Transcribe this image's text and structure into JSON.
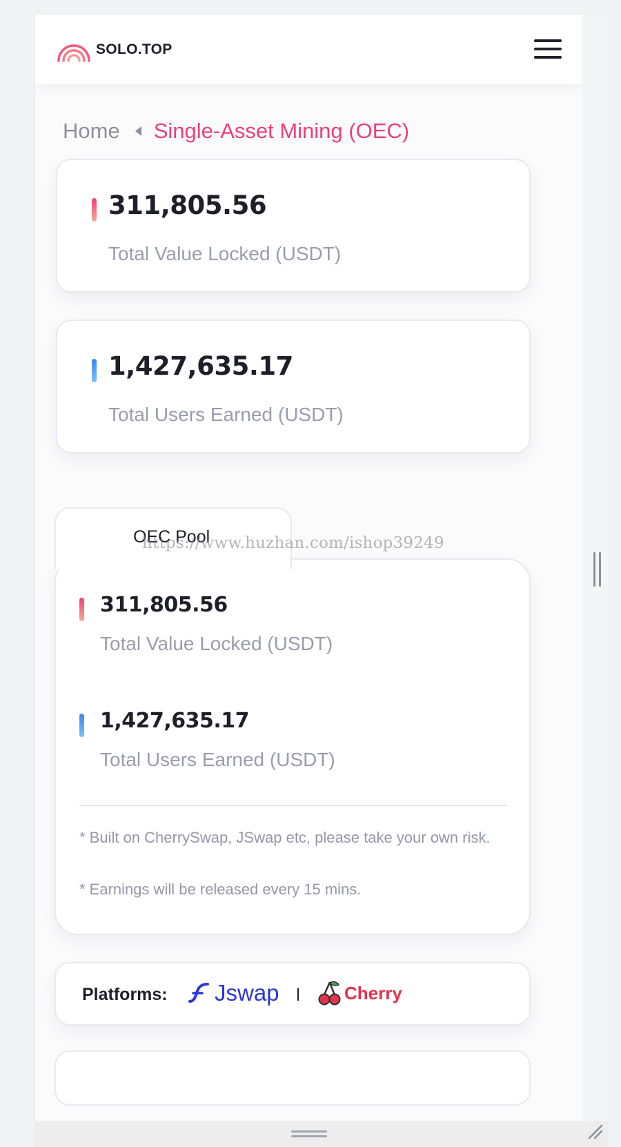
{
  "header": {
    "logo_text": "SOLO.TOP",
    "menu_icon": "hamburger-menu-icon"
  },
  "breadcrumb": {
    "home": "Home",
    "current": "Single-Asset Mining (OEC)"
  },
  "summary": [
    {
      "value": "311,805.56",
      "label": "Total Value Locked (USDT)",
      "accent": "#f0407a"
    },
    {
      "value": "1,427,635.17",
      "label": "Total Users Earned (USDT)",
      "accent": "#3a86f5"
    }
  ],
  "pool": {
    "tab_label": "OEC Pool",
    "stats": [
      {
        "value": "311,805.56",
        "label": "Total Value Locked (USDT)"
      },
      {
        "value": "1,427,635.17",
        "label": "Total Users Earned (USDT)"
      }
    ],
    "notes": [
      "* Built on CherrySwap, JSwap etc, please take your own risk.",
      "* Earnings will be released every 15 mins."
    ]
  },
  "watermark": "https://www.huzhan.com/ishop39249",
  "platforms": {
    "label": "Platforms:",
    "items": [
      {
        "name": "Jswap",
        "icon": "jswap-logo-icon",
        "color": "#2b36d8"
      },
      {
        "name": "Cherry",
        "icon": "cherry-logo-icon",
        "color": "#e2334e"
      }
    ]
  },
  "colors": {
    "accent_pink": "#ee3f7c",
    "accent_blue": "#3a86f5",
    "text_dark": "#1f1f2a",
    "text_muted": "#9a9cab"
  }
}
